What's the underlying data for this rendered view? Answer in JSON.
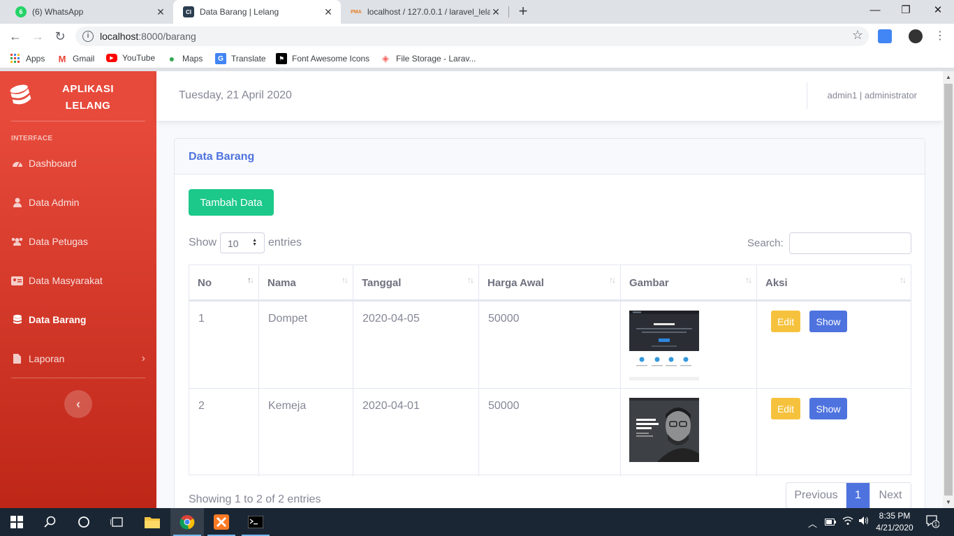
{
  "browser": {
    "tabs": [
      {
        "title": "(6) WhatsApp",
        "icon": "whatsapp-icon",
        "badge": "6"
      },
      {
        "title": "Data Barang | Lelang",
        "icon": "codeigniter-icon",
        "badge": "CI"
      },
      {
        "title": "localhost / 127.0.0.1 / laravel_lela",
        "icon": "phpmyadmin-icon",
        "badge": "PMA"
      }
    ],
    "url_host": "localhost",
    "url_path": ":8000/barang",
    "bookmarks": [
      "Apps",
      "Gmail",
      "YouTube",
      "Maps",
      "Translate",
      "Font Awesome Icons",
      "File Storage - Larav..."
    ]
  },
  "sidebar": {
    "brand_line1": "APLIKASI",
    "brand_line2": "LELANG",
    "heading": "INTERFACE",
    "items": [
      {
        "label": "Dashboard",
        "icon": "tachometer-icon"
      },
      {
        "label": "Data Admin",
        "icon": "user-icon"
      },
      {
        "label": "Data Petugas",
        "icon": "users-icon"
      },
      {
        "label": "Data Masyarakat",
        "icon": "id-card-icon"
      },
      {
        "label": "Data Barang",
        "icon": "database-icon",
        "active": true
      },
      {
        "label": "Laporan",
        "icon": "file-icon"
      }
    ]
  },
  "topbar": {
    "date": "Tuesday, 21 April 2020",
    "user": "admin1 | administrator"
  },
  "card": {
    "title": "Data Barang",
    "add_button": "Tambah Data",
    "show_label": "Show",
    "entries_value": "10",
    "entries_label": "entries",
    "search_label": "Search:",
    "search_value": "",
    "columns": [
      "No",
      "Nama",
      "Tanggal",
      "Harga Awal",
      "Gambar",
      "Aksi"
    ],
    "rows": [
      {
        "no": "1",
        "nama": "Dompet",
        "tanggal": "2020-04-05",
        "harga": "50000",
        "gambar": "website-screenshot-dark",
        "edit": "Edit",
        "show": "Show"
      },
      {
        "no": "2",
        "nama": "Kemeja",
        "tanggal": "2020-04-01",
        "harga": "50000",
        "gambar": "designer-portrait",
        "edit": "Edit",
        "show": "Show"
      }
    ],
    "info": "Showing 1 to 2 of 2 entries",
    "pagination": {
      "previous": "Previous",
      "current": "1",
      "next": "Next"
    }
  },
  "taskbar": {
    "time": "8:35 PM",
    "date": "4/21/2020",
    "notifications": "1"
  },
  "colors": {
    "sidebar": "#e74a3b",
    "primary": "#4e73df",
    "success": "#1cc88a",
    "warning": "#f6c23e"
  }
}
